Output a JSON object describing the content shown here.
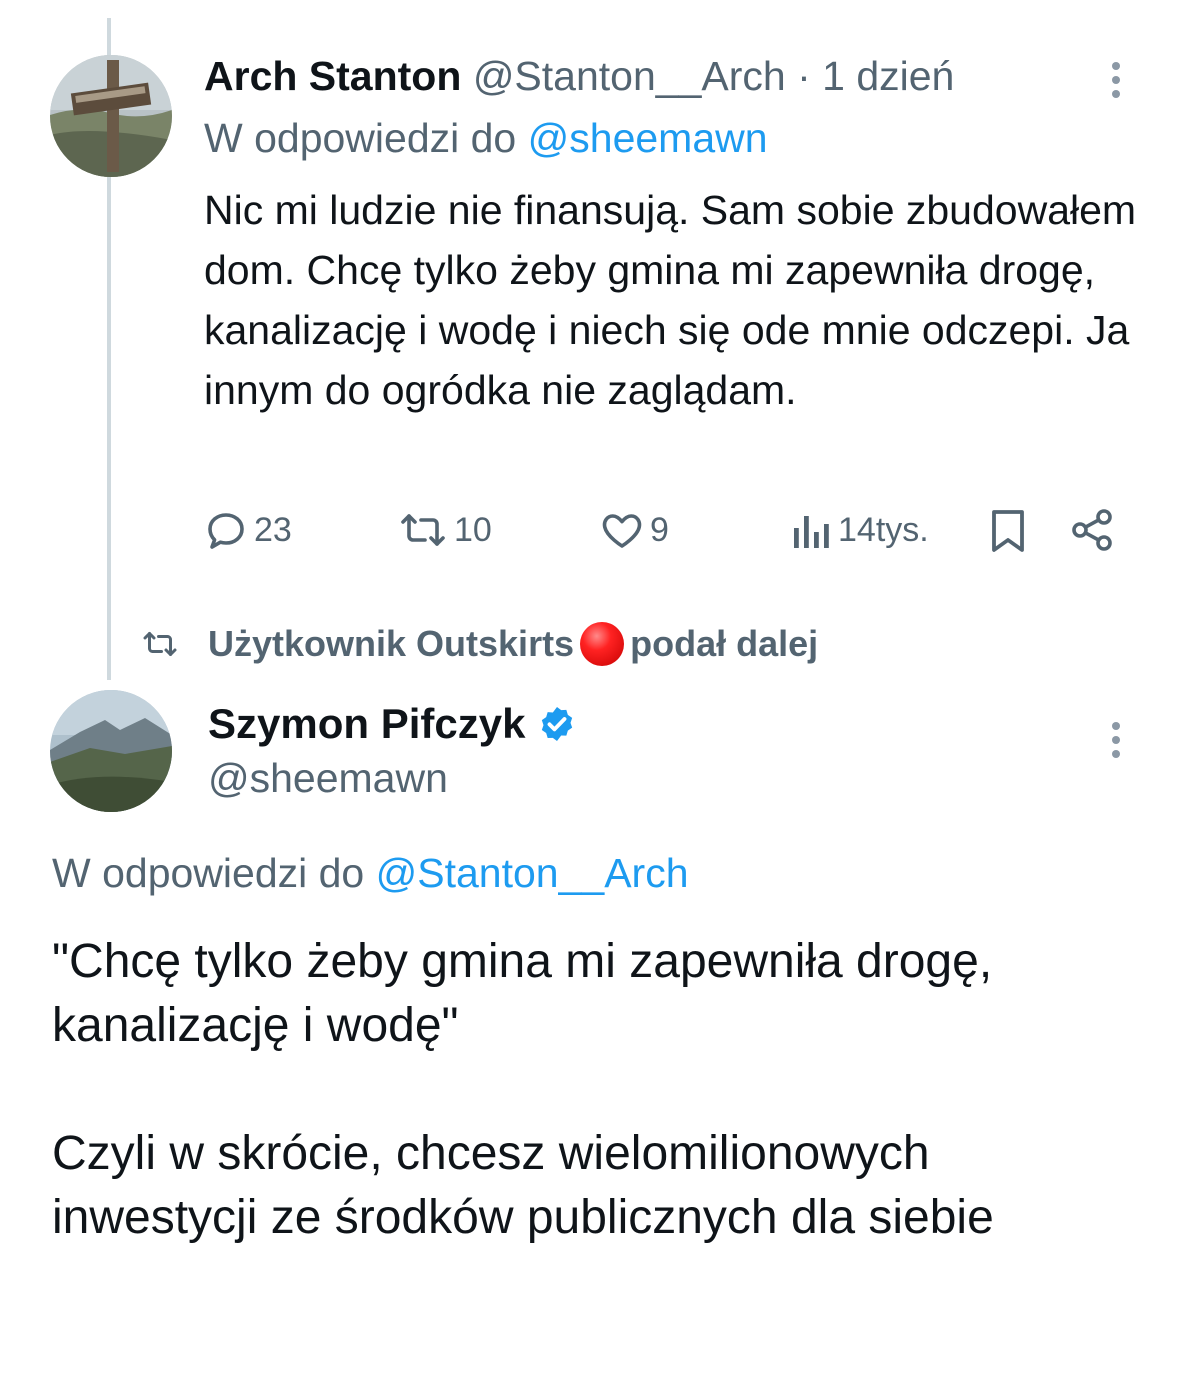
{
  "tweet1": {
    "author_name": "Arch Stanton",
    "author_handle": "@Stanton__Arch",
    "time": "· 1 dzień",
    "reply_prefix": "W odpowiedzi do",
    "reply_handle": "@sheemawn",
    "text": "Nic mi ludzie nie finansują. Sam sobie zbudowałem dom. Chcę tylko żeby gmina mi zapewniła drogę, kanalizację i wodę i niech się ode mnie odczepi. Ja innym do ogródka nie zaglądam.",
    "actions": {
      "replies": "23",
      "retweets": "10",
      "likes": "9",
      "views": "14tys."
    }
  },
  "retweet_notice": {
    "prefix": "Użytkownik Outskirts",
    "suffix": "podał dalej"
  },
  "tweet2": {
    "author_name": "Szymon Pifczyk",
    "author_handle": "@sheemawn",
    "reply_prefix": "W odpowiedzi do",
    "reply_handle": "@Stanton__Arch",
    "paragraph1": "\"Chcę tylko żeby gmina mi zapewniła drogę, kanalizację i wodę\"",
    "paragraph2": "Czyli w skrócie, chcesz wielomilionowych inwestycji ze środków publicznych dla siebie"
  },
  "colors": {
    "link": "#1d9bf0",
    "muted": "#536471",
    "text": "#0f1419",
    "thread_line": "#cfd9de"
  }
}
